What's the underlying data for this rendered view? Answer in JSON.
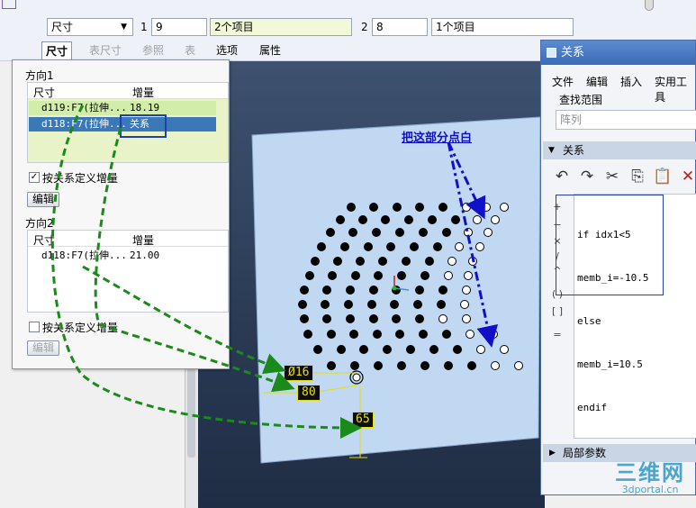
{
  "toolbar": {
    "dim_select": "尺寸",
    "field1_index": "1",
    "field1_value": "9",
    "field1_items": "2个项目",
    "field2_index": "2",
    "field2_value": "8",
    "field2_items": "1个项目",
    "tabs": [
      {
        "label": "尺寸",
        "active": true,
        "enabled": true
      },
      {
        "label": "表尺寸",
        "active": false,
        "enabled": false
      },
      {
        "label": "参照",
        "active": false,
        "enabled": false
      },
      {
        "label": "表",
        "active": false,
        "enabled": false
      },
      {
        "label": "选项",
        "active": false,
        "enabled": true
      },
      {
        "label": "属性",
        "active": false,
        "enabled": true
      }
    ]
  },
  "dim_panel": {
    "direction1_title": "方向1",
    "col_dim": "尺寸",
    "col_increment": "增量",
    "dir1_rows": [
      {
        "dim": "d119:F7(拉伸...",
        "inc": "18.19"
      },
      {
        "dim": "d118:F7(拉伸...",
        "inc": "关系"
      }
    ],
    "dir1_checkbox": "按关系定义增量",
    "dir1_checked": true,
    "edit_button": "编辑",
    "direction2_title": "方向2",
    "dir2_rows": [
      {
        "dim": "d118:F7(拉伸...",
        "inc": "21.00"
      }
    ],
    "dir2_checkbox": "按关系定义增量",
    "dir2_checked": false,
    "edit_button2": "编辑"
  },
  "viewport": {
    "annotation": "把这部分点白",
    "dim_tags": [
      "Ø16",
      "80",
      "65"
    ]
  },
  "relations": {
    "title": "关系",
    "menu": [
      "文件",
      "编辑",
      "插入",
      "实用工具"
    ],
    "search_label": "查找范围",
    "search_value": "阵列",
    "section_label": "关系",
    "side_buttons": [
      "+",
      "−",
      "×",
      "/",
      "^",
      "( )",
      "[ ]",
      "="
    ],
    "code_lines": [
      "if idx1<5",
      "memb_i=-10.5",
      "else",
      "memb_i=10.5",
      "endif"
    ],
    "local_params_label": "局部参数"
  },
  "watermark": {
    "cn": "三维网",
    "url": "3dportal.cn"
  },
  "colors": {
    "viewport_bg": "#2a3a54",
    "plate": "#c0d8f2",
    "annotation": "#1010c8",
    "arrow_green": "#1a8a1a",
    "highlight_row": "#3b78b8",
    "callout_box": "#2040b0"
  }
}
